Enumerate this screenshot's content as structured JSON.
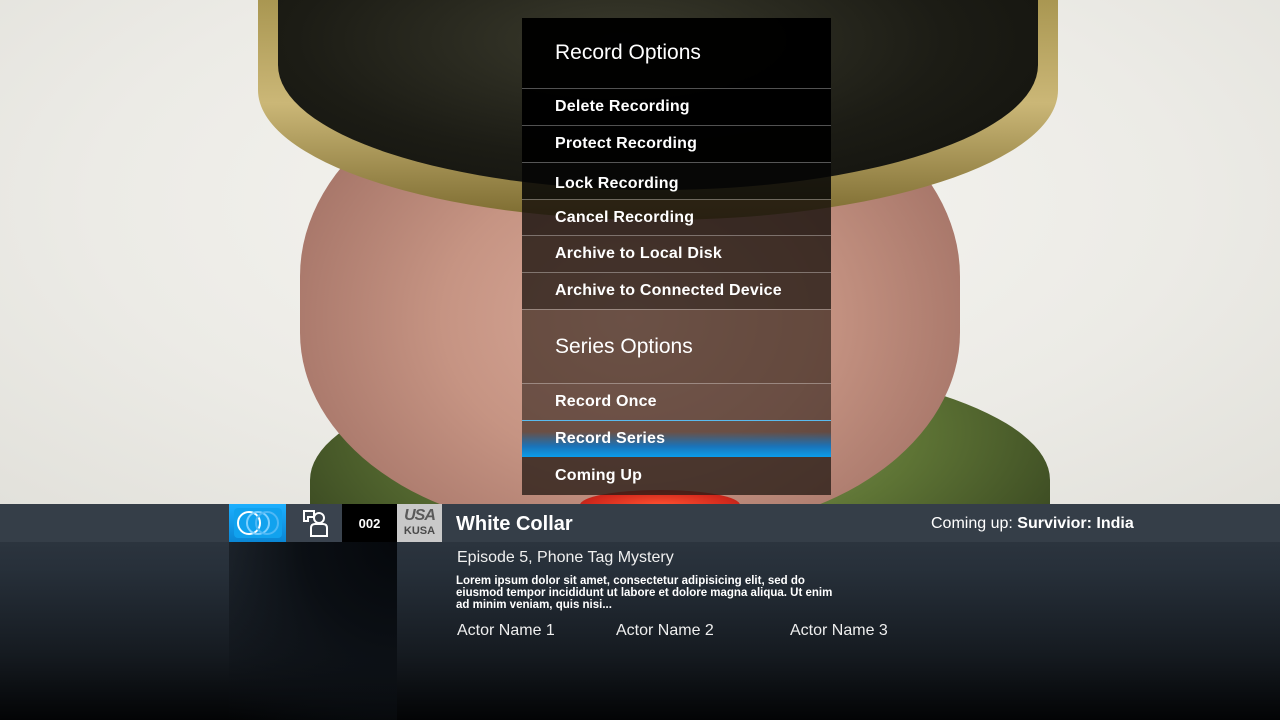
{
  "record_options": {
    "heading": "Record Options",
    "items": [
      "Delete Recording",
      "Protect Recording",
      "Lock Recording",
      "Cancel Recording",
      "Archive to Local Disk",
      "Archive to Connected Device"
    ]
  },
  "series_options": {
    "heading": "Series Options",
    "items": [
      "Record Once",
      "Record Series",
      "Coming Up"
    ],
    "selected_index": 1
  },
  "info_bar": {
    "icons": [
      "record-icon",
      "person-icon"
    ],
    "channel_number": "002",
    "channel_logo_top": "USA",
    "channel_logo_bottom": "KUSA",
    "show_title": "White Collar",
    "coming_up_label": "Coming up:",
    "coming_up_show": "Survivior: India",
    "episode": "Episode 5, Phone Tag Mystery",
    "description": "Lorem ipsum dolor sit amet, consectetur adipisicing elit, sed do eiusmod tempor incididunt ut labore et dolore magna aliqua. Ut enim ad minim veniam, quis nisi...",
    "actors": [
      "Actor Name 1",
      "Actor Name 2",
      "Actor Name 3"
    ]
  },
  "colors": {
    "accent": "#0b9dea",
    "bar": "#353e48"
  }
}
